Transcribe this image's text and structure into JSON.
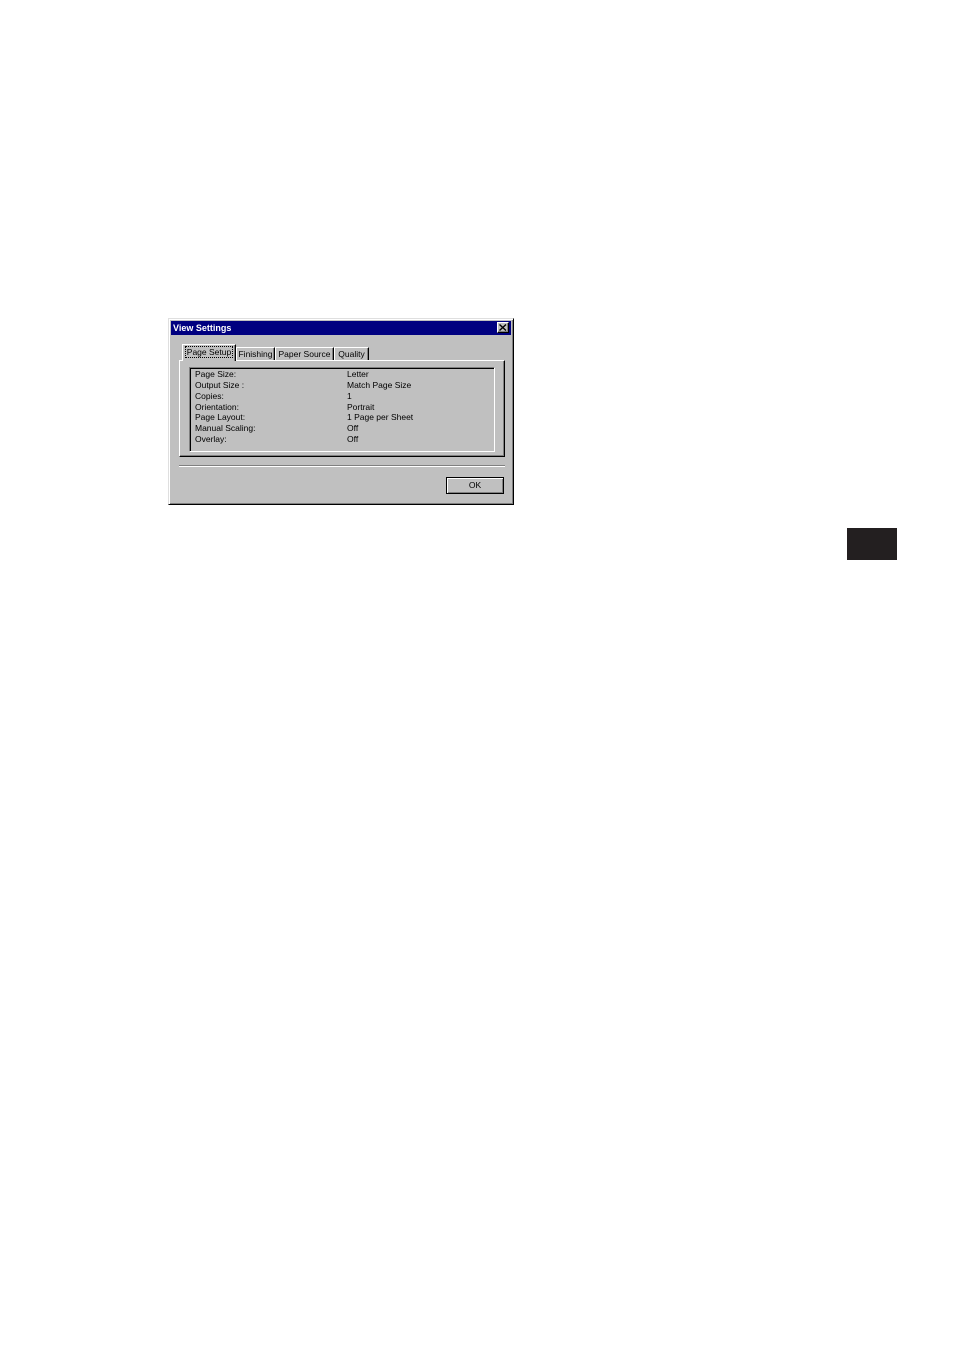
{
  "dialog": {
    "title": "View Settings",
    "close_icon": "close-x-icon",
    "tabs": [
      {
        "label": "Page Setup",
        "active": true
      },
      {
        "label": "Finishing",
        "active": false
      },
      {
        "label": "Paper Source",
        "active": false
      },
      {
        "label": "Quality",
        "active": false
      }
    ],
    "settings": [
      {
        "label": "Page Size:",
        "value": "Letter"
      },
      {
        "label": "Output Size :",
        "value": "Match Page Size"
      },
      {
        "label": "Copies:",
        "value": "1"
      },
      {
        "label": "Orientation:",
        "value": "Portrait"
      },
      {
        "label": "Page Layout:",
        "value": "1 Page per Sheet"
      },
      {
        "label": "Manual Scaling:",
        "value": "Off"
      },
      {
        "label": "Overlay:",
        "value": "Off"
      }
    ],
    "ok_label": "OK"
  },
  "colors": {
    "titlebar": "#000080",
    "dialog_face": "#c0c0c0",
    "side_tab": "#231f20"
  }
}
